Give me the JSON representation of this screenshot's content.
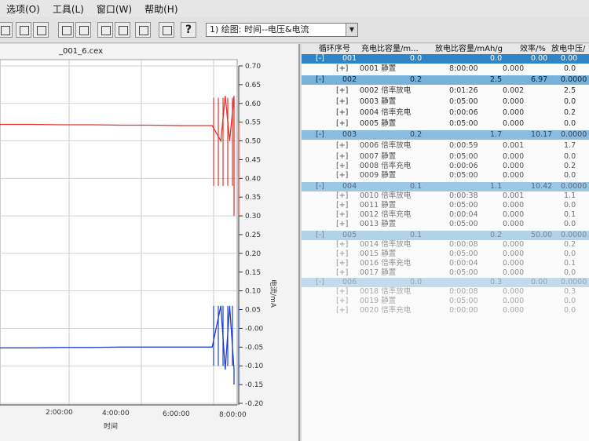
{
  "menubar": {
    "items": [
      "选项(O)",
      "工具(L)",
      "窗口(W)",
      "帮助(H)"
    ]
  },
  "toolbar": {
    "plot_select": "1) 绘图: 时间--电压&电流",
    "help_label": "?"
  },
  "chart": {
    "file_title": "_001_6.cex",
    "right_axis_label": "电流/mA",
    "x_axis_label": "时间",
    "colors": {
      "voltage": "#e8312a",
      "current": "#1f3fd0"
    }
  },
  "chart_data": {
    "type": "line",
    "xlabel": "时间",
    "ylabel": "电流/mA",
    "x_ticks": [
      "2:00:00",
      "4:00:00",
      "6:00:00",
      "8:00:00"
    ],
    "y_ticks": [
      "0.70",
      "0.65",
      "0.60",
      "0.55",
      "0.50",
      "0.45",
      "0.40",
      "0.35",
      "0.30",
      "0.25",
      "0.20",
      "0.15",
      "0.10",
      "0.05",
      "-0.00",
      "-0.05",
      "-0.10",
      "-0.15",
      "-0.20"
    ],
    "ylim": [
      -0.2,
      0.7
    ],
    "grid": true,
    "series": [
      {
        "color": "#e8312a",
        "x": [
          0.0,
          1.0,
          2.0,
          3.0,
          4.0,
          5.0,
          6.0,
          7.0,
          7.4,
          7.6,
          7.8,
          8.0,
          8.2
        ],
        "y": [
          0.544,
          0.544,
          0.543,
          0.543,
          0.542,
          0.542,
          0.541,
          0.541,
          0.5,
          0.62,
          0.5,
          0.62,
          0.3
        ]
      },
      {
        "color": "#1f3fd0",
        "x": [
          0.0,
          1.0,
          2.0,
          3.0,
          4.0,
          5.0,
          6.0,
          7.0,
          7.4,
          7.6,
          7.8,
          8.0,
          8.2
        ],
        "y": [
          -0.052,
          -0.052,
          -0.051,
          -0.051,
          -0.05,
          -0.05,
          -0.05,
          -0.05,
          0.06,
          -0.11,
          0.06,
          -0.11,
          -0.15
        ]
      }
    ]
  },
  "table": {
    "headers": [
      "循环序号",
      "充电比容量/m...",
      "放电比容量/mAh/g",
      "效率/%",
      "放电中压/"
    ],
    "rows": [
      {
        "kind": "cycle",
        "toggle": "[-]",
        "id": "001",
        "c1": "0.0",
        "c2": "0.0",
        "c3": "0.00",
        "c4": "0.00"
      },
      {
        "kind": "step",
        "toggle": "[+]",
        "name": "0001 静置",
        "t": "8:00:00",
        "v": "0.000",
        "m": "0.0"
      },
      {
        "kind": "cycle",
        "toggle": "[-]",
        "id": "002",
        "c1": "0.2",
        "c2": "2.5",
        "c3": "6.97",
        "c4": "0.0000"
      },
      {
        "kind": "step",
        "toggle": "[+]",
        "name": "0002 倍率放电",
        "t": "0:01:26",
        "v": "0.002",
        "m": "2.5"
      },
      {
        "kind": "step",
        "toggle": "[+]",
        "name": "0003 静置",
        "t": "0:05:00",
        "v": "0.000",
        "m": "0.0"
      },
      {
        "kind": "step",
        "toggle": "[+]",
        "name": "0004 倍率充电",
        "t": "0:00:06",
        "v": "0.000",
        "m": "0.2"
      },
      {
        "kind": "step",
        "toggle": "[+]",
        "name": "0005 静置",
        "t": "0:05:00",
        "v": "0.000",
        "m": "0.0"
      },
      {
        "kind": "cycle",
        "toggle": "[-]",
        "id": "003",
        "c1": "0.2",
        "c2": "1.7",
        "c3": "10.17",
        "c4": "0.0000"
      },
      {
        "kind": "step",
        "toggle": "[+]",
        "name": "0006 倍率放电",
        "t": "0:00:59",
        "v": "0.001",
        "m": "1.7"
      },
      {
        "kind": "step",
        "toggle": "[+]",
        "name": "0007 静置",
        "t": "0:05:00",
        "v": "0.000",
        "m": "0.0"
      },
      {
        "kind": "step",
        "toggle": "[+]",
        "name": "0008 倍率充电",
        "t": "0:00:06",
        "v": "0.000",
        "m": "0.2"
      },
      {
        "kind": "step",
        "toggle": "[+]",
        "name": "0009 静置",
        "t": "0:05:00",
        "v": "0.000",
        "m": "0.0"
      },
      {
        "kind": "cycle",
        "toggle": "[-]",
        "id": "004",
        "c1": "0.1",
        "c2": "1.1",
        "c3": "10.42",
        "c4": "0.0000"
      },
      {
        "kind": "step",
        "toggle": "[+]",
        "name": "0010 倍率放电",
        "t": "0:00:38",
        "v": "0.001",
        "m": "1.1"
      },
      {
        "kind": "step",
        "toggle": "[+]",
        "name": "0011 静置",
        "t": "0:05:00",
        "v": "0.000",
        "m": "0.0"
      },
      {
        "kind": "step",
        "toggle": "[+]",
        "name": "0012 倍率充电",
        "t": "0:00:04",
        "v": "0.000",
        "m": "0.1"
      },
      {
        "kind": "step",
        "toggle": "[+]",
        "name": "0013 静置",
        "t": "0:05:00",
        "v": "0.000",
        "m": "0.0"
      },
      {
        "kind": "cycle",
        "toggle": "[-]",
        "id": "005",
        "c1": "0.1",
        "c2": "0.2",
        "c3": "50.00",
        "c4": "0.0000"
      },
      {
        "kind": "step",
        "toggle": "[+]",
        "name": "0014 倍率放电",
        "t": "0:00:08",
        "v": "0.000",
        "m": "0.2"
      },
      {
        "kind": "step",
        "toggle": "[+]",
        "name": "0015 静置",
        "t": "0:05:00",
        "v": "0.000",
        "m": "0.0"
      },
      {
        "kind": "step",
        "toggle": "[+]",
        "name": "0016 倍率充电",
        "t": "0:00:04",
        "v": "0.000",
        "m": "0.1"
      },
      {
        "kind": "step",
        "toggle": "[+]",
        "name": "0017 静置",
        "t": "0:05:00",
        "v": "0.000",
        "m": "0.0"
      },
      {
        "kind": "cycle",
        "toggle": "[-]",
        "id": "006",
        "c1": "0.0",
        "c2": "0.3",
        "c3": "0.00",
        "c4": "0.0000"
      },
      {
        "kind": "step",
        "toggle": "[+]",
        "name": "0018 倍率放电",
        "t": "0:00:08",
        "v": "0.000",
        "m": "0.3"
      },
      {
        "kind": "step",
        "toggle": "[+]",
        "name": "0019 静置",
        "t": "0:05:00",
        "v": "0.000",
        "m": "0.0"
      },
      {
        "kind": "step",
        "toggle": "[+]",
        "name": "0020 倍率充电",
        "t": "0:00:00",
        "v": "0.000",
        "m": "0.0"
      }
    ]
  }
}
